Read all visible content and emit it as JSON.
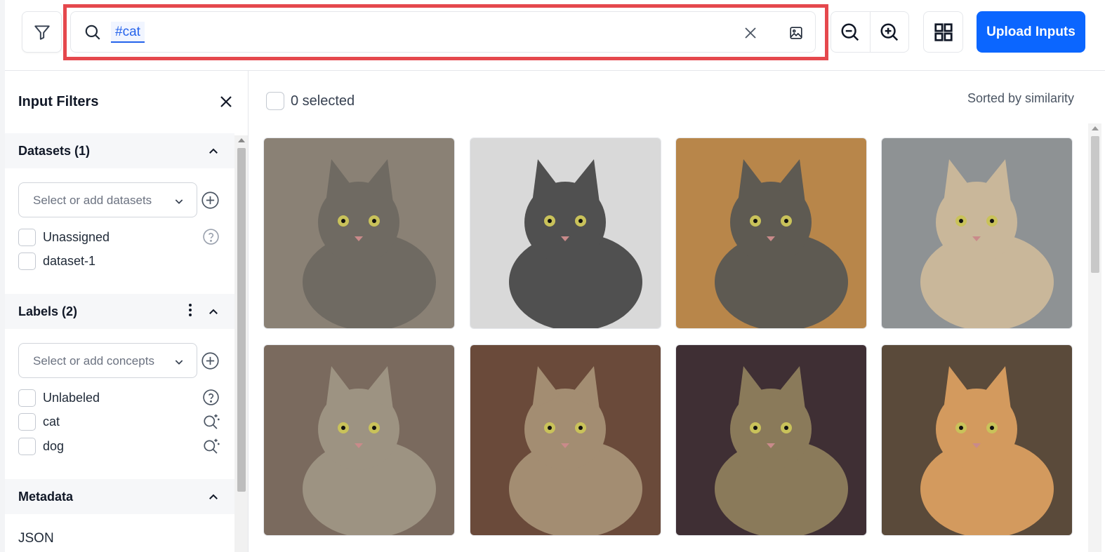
{
  "toolbar": {
    "filter_icon": "filter-icon",
    "search_icon": "search-icon",
    "search_query": "#cat",
    "clear_icon": "close-icon",
    "image_search_icon": "image-icon",
    "zoom_out_icon": "zoom-out-icon",
    "zoom_in_icon": "zoom-in-icon",
    "grid_view_icon": "grid-icon",
    "upload_label": "Upload Inputs",
    "upload_color": "#0b66ff",
    "highlight_color": "#e5484d"
  },
  "sidebar": {
    "title": "Input Filters",
    "datasets": {
      "header": "Datasets (1)",
      "placeholder": "Select or add datasets",
      "options": [
        {
          "label": "Unassigned",
          "icon": "help-circle-icon"
        },
        {
          "label": "dataset-1"
        }
      ]
    },
    "labels": {
      "header": "Labels (2)",
      "placeholder": "Select or add concepts",
      "options": [
        {
          "label": "Unlabeled",
          "icon": "help-circle-icon"
        },
        {
          "label": "cat",
          "icon": "magic-search-icon"
        },
        {
          "label": "dog",
          "icon": "magic-search-icon"
        }
      ]
    },
    "metadata": {
      "header": "Metadata",
      "json_label": "JSON"
    }
  },
  "main": {
    "selected_label": "0 selected",
    "sort_label": "Sorted by similarity",
    "images": [
      {
        "name": "cat-image-1",
        "bg": "#8a8175",
        "fur": "#6f6a62"
      },
      {
        "name": "cat-image-2",
        "bg": "#d9d9d9",
        "fur": "#505050"
      },
      {
        "name": "cat-image-3",
        "bg": "#b8864a",
        "fur": "#5e5a52"
      },
      {
        "name": "cat-image-4",
        "bg": "#8e9294",
        "fur": "#c9b79a"
      },
      {
        "name": "cat-image-5",
        "bg": "#7a6a5e",
        "fur": "#9d9382"
      },
      {
        "name": "cat-image-6",
        "bg": "#6a4a3a",
        "fur": "#a38d72"
      },
      {
        "name": "cat-image-7",
        "bg": "#3f2f34",
        "fur": "#8a7a5a"
      },
      {
        "name": "cat-image-8",
        "bg": "#5a4a3a",
        "fur": "#d39a5e"
      }
    ]
  }
}
